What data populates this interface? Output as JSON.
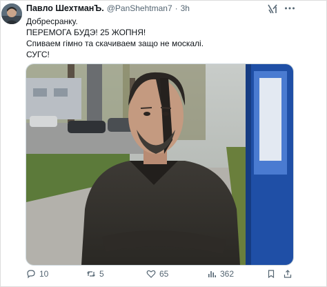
{
  "tweet": {
    "author_name": "Павло ШехтманЪ.",
    "handle": "@PanShehtman7",
    "separator": "·",
    "time": "3h",
    "lines": [
      "Добресранку.",
      "ПЕРЕМОГА БУДЭ! 25 ЖОПНЯ!",
      "Спиваем гімно та скачиваем защо не москалі.",
      "СУГС!"
    ]
  },
  "icons": {
    "grok": "grok-icon",
    "more": "more-icon",
    "reply": "reply-icon",
    "repost": "repost-icon",
    "like": "heart-icon",
    "views": "views-icon",
    "bookmark": "bookmark-icon",
    "share": "share-icon"
  },
  "actions": {
    "replies": "10",
    "reposts": "5",
    "likes": "65",
    "views": "362"
  },
  "colors": {
    "text": "#0f1419",
    "secondary": "#536471",
    "border": "#cfd9de"
  }
}
